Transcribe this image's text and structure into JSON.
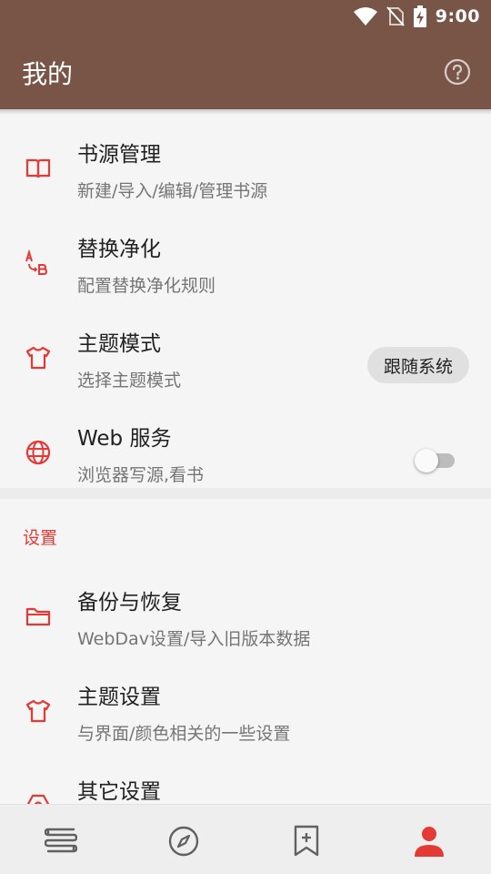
{
  "status_bar": {
    "time": "9:00"
  },
  "app_bar": {
    "title": "我的"
  },
  "menu_items": [
    {
      "title": "书源管理",
      "subtitle": "新建/导入/编辑/管理书源"
    },
    {
      "title": "替换净化",
      "subtitle": "配置替换净化规则"
    },
    {
      "title": "主题模式",
      "subtitle": "选择主题模式",
      "value": "跟随系统"
    },
    {
      "title": "Web 服务",
      "subtitle": "浏览器写源,看书",
      "enabled": false
    }
  ],
  "settings_section": {
    "header": "设置",
    "items": [
      {
        "title": "备份与恢复",
        "subtitle": "WebDav设置/导入旧版本数据"
      },
      {
        "title": "主题设置",
        "subtitle": "与界面/颜色相关的一些设置"
      },
      {
        "title": "其它设置"
      }
    ]
  },
  "bottom_nav": {
    "tabs": [
      "bookshelf-icon",
      "explore-icon",
      "rss-icon",
      "my-icon"
    ],
    "selected": "my-icon"
  },
  "colors": {
    "app_bar": "#795548",
    "accent": "#e53935",
    "background": "#f5f5f5",
    "nav_inactive": "#616161"
  }
}
